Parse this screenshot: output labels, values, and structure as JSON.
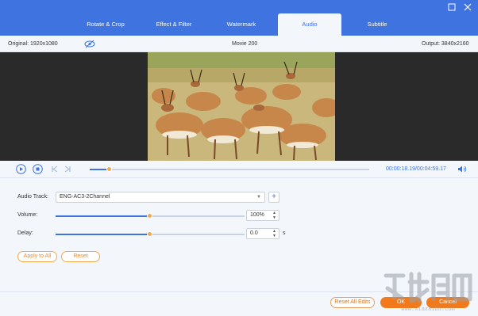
{
  "window": {
    "tabs": [
      {
        "label": "Rotate & Crop",
        "active": false
      },
      {
        "label": "Effect & Filter",
        "active": false
      },
      {
        "label": "Watermark",
        "active": false
      },
      {
        "label": "Audio",
        "active": true
      },
      {
        "label": "Subtitle",
        "active": false
      }
    ],
    "minimize_icon": "minimize-icon",
    "close_icon": "close-icon"
  },
  "infobar": {
    "original": "Original: 1920x1080",
    "title": "Movie 200",
    "output": "Output: 3840x2160",
    "eye_icon": "eye-off-icon"
  },
  "player": {
    "play_icon": "play-icon",
    "stop_icon": "stop-icon",
    "prev_icon": "prev-frame-icon",
    "next_icon": "next-frame-icon",
    "time": "00:00:18.19/00:04:59.17",
    "progress": 0.07,
    "volume_icon": "volume-icon"
  },
  "audio": {
    "track_label": "Audio Track:",
    "track_value": "ENG-AC3-2Channel",
    "volume_label": "Volume:",
    "volume_value": "100%",
    "volume_level": 0.5,
    "delay_label": "Delay:",
    "delay_value": "0.0",
    "delay_unit": "s",
    "delay_level": 0.5,
    "apply_all": "Apply to All",
    "reset": "Reset"
  },
  "footer": {
    "reset_all": "Reset All Edits",
    "ok": "OK",
    "cancel": "Cancel"
  },
  "colors": {
    "accent": "#3f73e0",
    "orange": "#f27a1a",
    "knob": "#f2a94e"
  }
}
